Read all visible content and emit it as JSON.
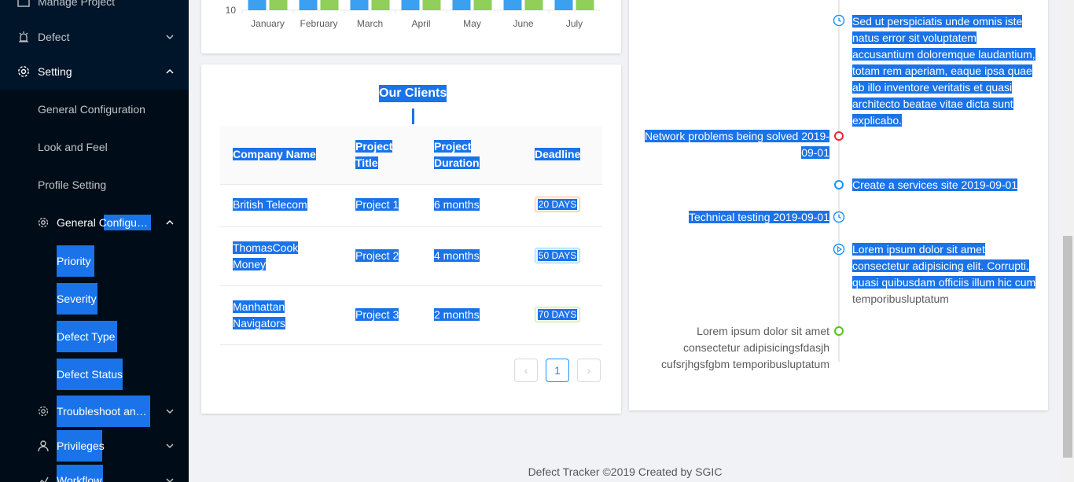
{
  "sidebar": {
    "top_items": [
      {
        "label": "Manage Project",
        "icon": "project-icon"
      },
      {
        "label": "Defect",
        "icon": "bug-icon"
      },
      {
        "label": "Setting",
        "icon": "gear-icon"
      }
    ],
    "setting_children": [
      {
        "label": "General Configuration"
      },
      {
        "label": "Look and Feel"
      },
      {
        "label": "Profile Setting"
      }
    ],
    "general_config": {
      "label": "General Configuration",
      "children": [
        "Priority",
        "Severity",
        "Defect Type",
        "Defect Status"
      ]
    },
    "troubleshoot": {
      "label": "Troubleshoot and Setup"
    },
    "privileges": {
      "label": "Privileges"
    },
    "workflow": {
      "label": "Workflow"
    }
  },
  "chart": {
    "y_tick": "10",
    "categories": [
      "January",
      "February",
      "March",
      "April",
      "May",
      "June",
      "July"
    ],
    "colors": {
      "series1": "#3ca0f0",
      "series2": "#8fcf5a"
    }
  },
  "clients": {
    "title": "Our Clients",
    "columns": [
      "Company Name",
      "Project Title",
      "Project Duration",
      "Deadline"
    ],
    "rows": [
      {
        "company": "British Telecom",
        "project": "Project 1",
        "duration": "6 months",
        "deadline": "20 DAYS",
        "tag_color": "#fa8c16"
      },
      {
        "company": "ThomasCook Money",
        "project": "Project 2",
        "duration": "4 months",
        "deadline": "50 DAYS",
        "tag_color": "#1890ff"
      },
      {
        "company": "Manhattan Navigators",
        "project": "Project 3",
        "duration": "2 months",
        "deadline": "70 DAYS",
        "tag_color": "#52c41a"
      }
    ],
    "pagination": {
      "prev": "‹",
      "current": "1",
      "next": "›"
    }
  },
  "timeline": [
    {
      "text": "Sed ut perspiciatis unde omnis iste natus error sit voluptatem accusantium doloremque laudantium, totam rem aperiam, eaque ipsa quae ab illo inventore veritatis et quasi architecto beatae vitae dicta sunt explicabo.",
      "side": "right",
      "icon": "clock-icon"
    },
    {
      "text": "Network problems being solved 2019-09-01",
      "side": "left",
      "icon": "red-dot",
      "color": "#f5222d"
    },
    {
      "text": "Create a services site 2019-09-01",
      "side": "right",
      "icon": "blue-dot",
      "color": "#1890ff"
    },
    {
      "text": "Technical testing 2019-09-01",
      "side": "left",
      "icon": "clock-icon"
    },
    {
      "text": "Lorem ipsum dolor sit amet consectetur adipisicing elit. Corrupti, quasi quibusdam officiis illum hic cum",
      "text_tail": "temporibusluptatum",
      "side": "right",
      "icon": "play-icon"
    },
    {
      "text": "Lorem ipsum dolor sit amet consectetur adipisicingsfdasjh cufsrjhgsfgbm temporibusluptatum",
      "side": "left",
      "icon": "green-dot",
      "color": "#52c41a"
    }
  ],
  "footer": {
    "text": "Defect Tracker ©2019 Created by SGIC"
  }
}
